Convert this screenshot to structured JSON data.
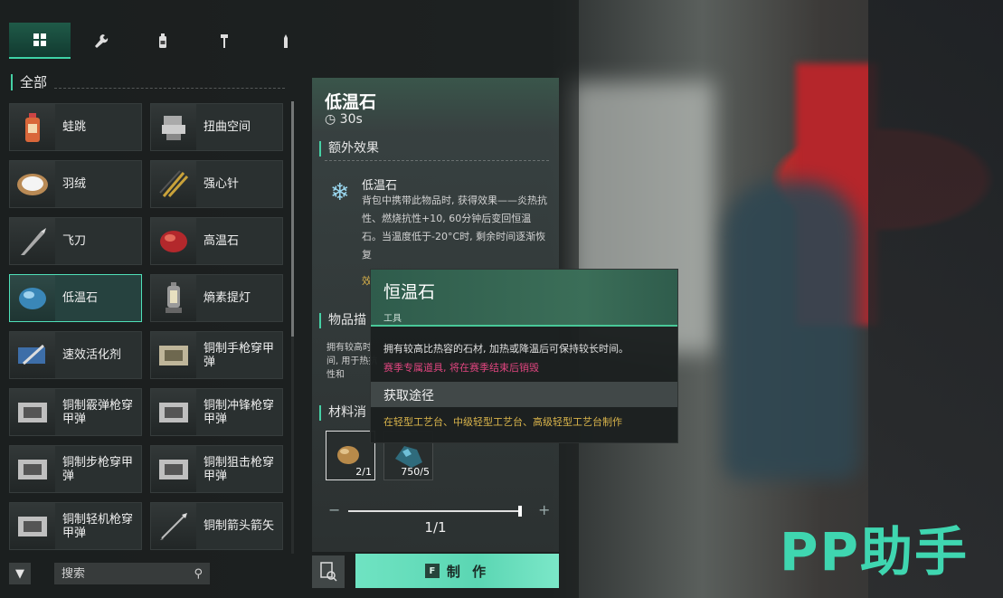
{
  "tabs": [
    {
      "icon": "grid-icon",
      "active": true
    },
    {
      "icon": "wrench-icon",
      "active": false
    },
    {
      "icon": "bottle-icon",
      "active": false
    },
    {
      "icon": "hammer-icon",
      "active": false
    },
    {
      "icon": "bullet-icon",
      "active": false
    }
  ],
  "category_title": "全部",
  "items": [
    {
      "name": "蛙跳"
    },
    {
      "name": "扭曲空间"
    },
    {
      "name": "羽绒"
    },
    {
      "name": "强心针"
    },
    {
      "name": "飞刀"
    },
    {
      "name": "高温石"
    },
    {
      "name": "低温石",
      "selected": true
    },
    {
      "name": "熵素提灯"
    },
    {
      "name": "速效活化剂"
    },
    {
      "name": "铜制手枪穿甲弹"
    },
    {
      "name": "铜制霰弹枪穿甲弹"
    },
    {
      "name": "铜制冲锋枪穿甲弹"
    },
    {
      "name": "铜制步枪穿甲弹"
    },
    {
      "name": "铜制狙击枪穿甲弹"
    },
    {
      "name": "铜制轻机枪穿甲弹"
    },
    {
      "name": "铜制箭头箭矢"
    }
  ],
  "search": {
    "placeholder": "搜索"
  },
  "detail": {
    "title": "低温石",
    "time": "30s",
    "extra_effect_title": "额外效果",
    "effect_name": "低温石",
    "effect_text": "背包中携带此物品时, 获得效果——炎热抗性、燃烧抗性+10, 60分钟后变回恒温石。当温度低于-20°C时, 剩余时间逐渐恢复",
    "effect_more": "效",
    "desc_title": "物品描",
    "desc_text": "拥有较高时间, 用于热抗性和",
    "materials_title": "材料消",
    "materials": [
      {
        "count": "2/1",
        "selected": true
      },
      {
        "count": "750/5",
        "selected": false
      }
    ],
    "quantity": "1/1",
    "quantity_fraction": 1.0
  },
  "make_button": {
    "key": "F",
    "label": "制 作"
  },
  "tooltip": {
    "title": "恒温石",
    "type": "工具",
    "desc": "拥有较高比热容的石材, 加热或降温后可保持较长时间。",
    "season": "赛季专属道具, 将在赛季结束后销毁",
    "source_title": "获取途径",
    "source": "在轻型工艺台、中级轻型工艺台、高级轻型工艺台制作"
  },
  "watermark": "PP助手",
  "colors": {
    "accent": "#45d1a5",
    "season_text": "#e0457f",
    "source_text": "#d9b44b"
  }
}
